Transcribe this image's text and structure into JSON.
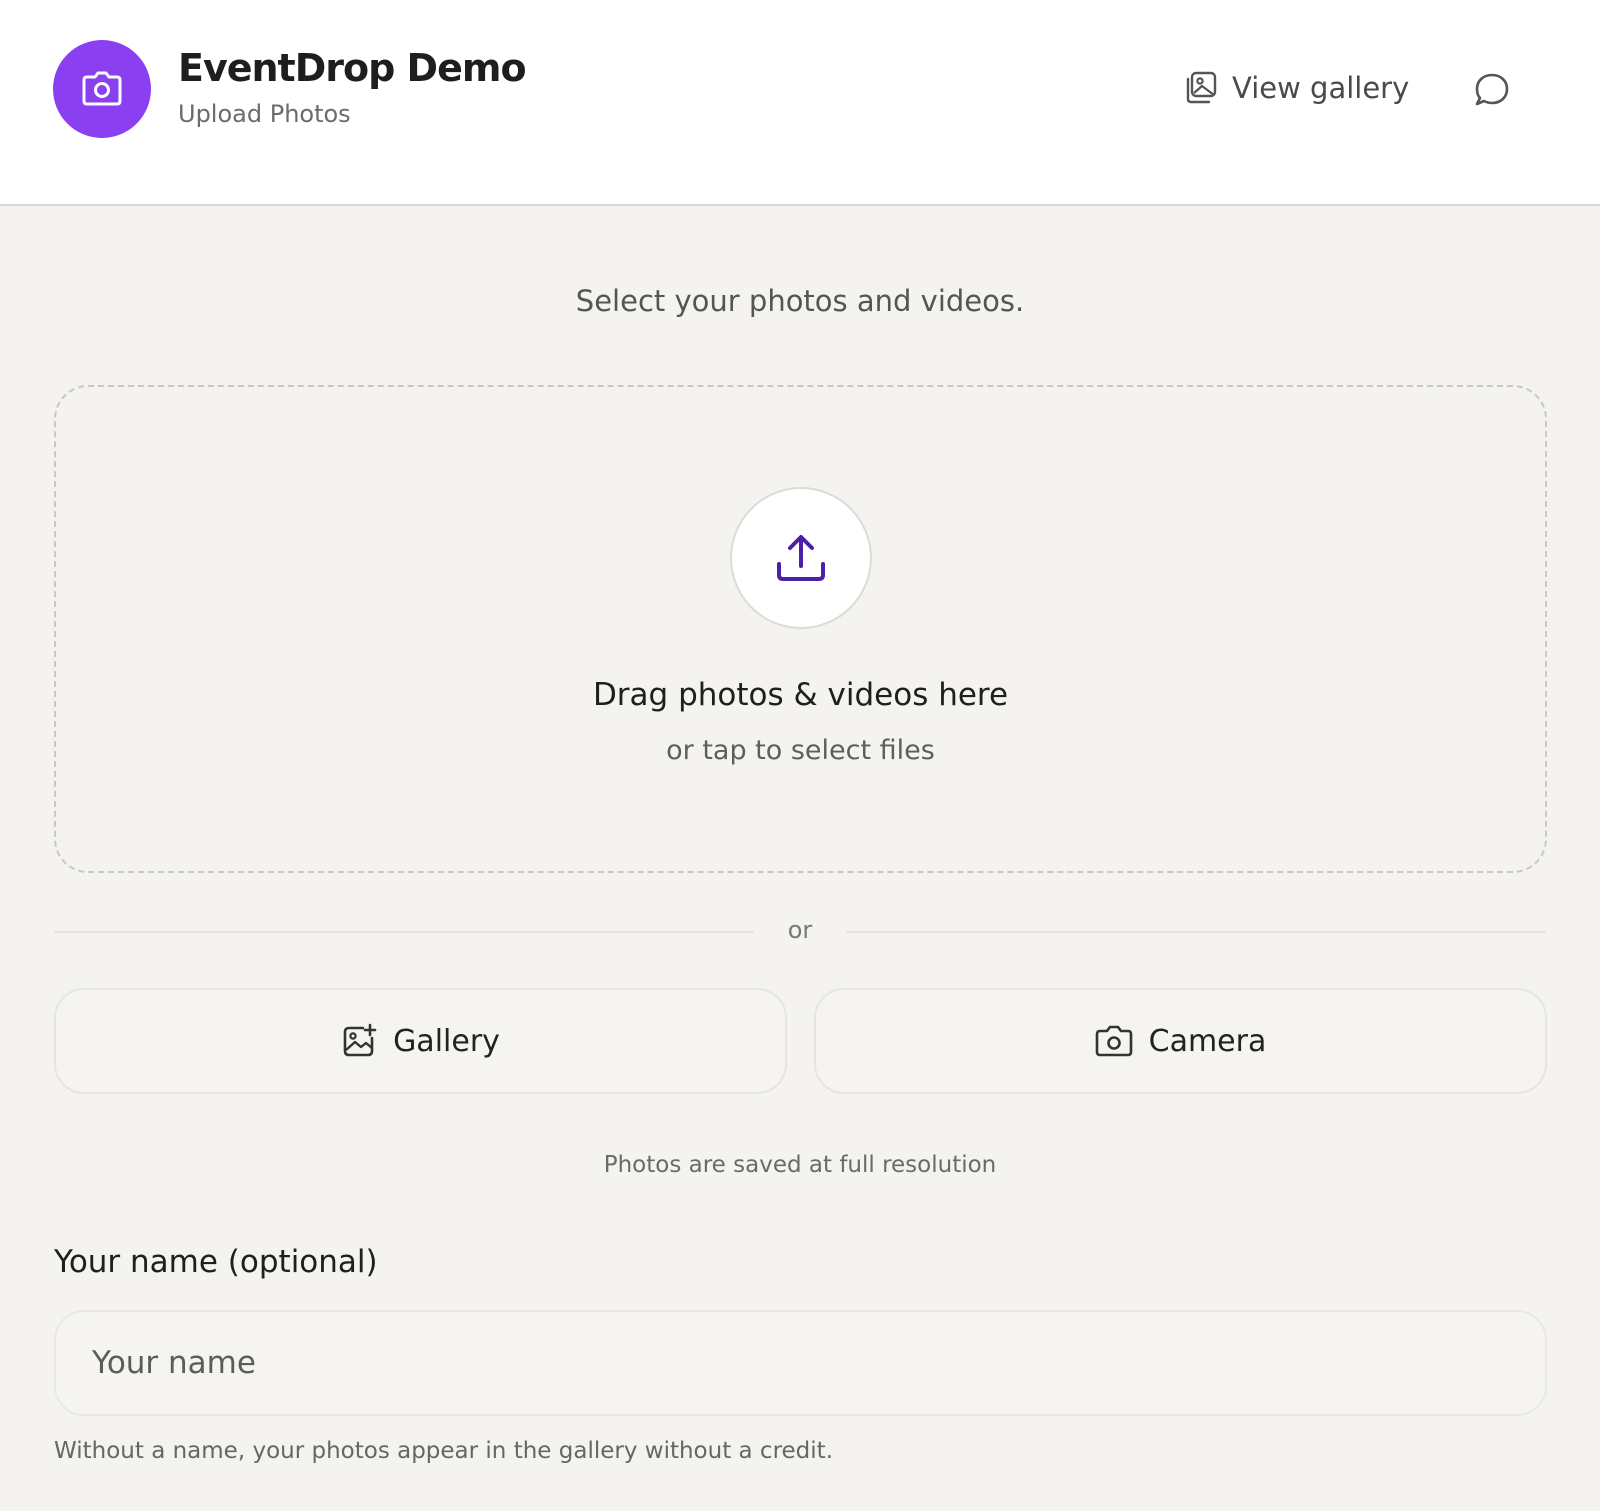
{
  "header": {
    "app_title": "EventDrop Demo",
    "app_subtitle": "Upload Photos",
    "logo_icon": "camera-icon",
    "view_gallery_label": "View gallery",
    "view_gallery_icon": "gallery-icon",
    "chat_icon": "chat-bubble-icon"
  },
  "upload": {
    "prompt": "Select your photos and videos.",
    "drop_title": "Drag photos & videos here",
    "drop_subtitle": "or tap to select files",
    "upload_icon": "upload-icon",
    "divider_text": "or",
    "gallery_button_label": "Gallery",
    "gallery_button_icon": "image-add-icon",
    "camera_button_label": "Camera",
    "camera_button_icon": "camera-icon",
    "resolution_note": "Photos are saved at full resolution"
  },
  "name_field": {
    "label": "Your name (optional)",
    "placeholder": "Your name",
    "value": "",
    "hint": "Without a name, your photos appear in the gallery without a credit."
  },
  "colors": {
    "accent": "#8a3ff0",
    "icon_accent": "#4b1fa8",
    "background": "#f4f3ef",
    "header_background": "#ffffff"
  }
}
